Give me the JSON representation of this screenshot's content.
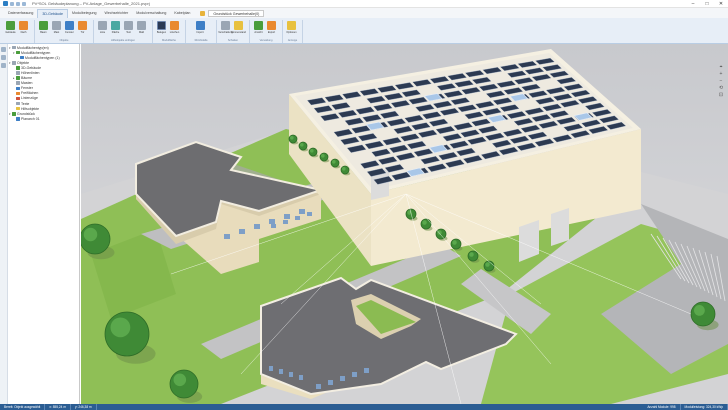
{
  "window": {
    "title": "PV*SOL Gebäudeplanung – PV-Anlage_Gewerbehalle_2021.pvprj",
    "controls": [
      "–",
      "□",
      "✕"
    ]
  },
  "menubar": {
    "tabs": [
      "Datenerfassung",
      "3D-Gebäude",
      "Modulbelegung",
      "Wechselrichter",
      "Modulverschaltung",
      "Kabelplan"
    ],
    "active_tab": "3D-Gebäude",
    "context_selector": "Grundstück Gewerbehalle(0)"
  },
  "ribbon": {
    "groups": [
      {
        "caption": "",
        "buttons": [
          {
            "label": "Gebäude",
            "icon": "building-icon",
            "color": "green"
          },
          {
            "label": "Dach",
            "icon": "roof-icon",
            "color": "orange"
          }
        ]
      },
      {
        "caption": "Objekte",
        "buttons": [
          {
            "label": "Baum",
            "icon": "tree-icon",
            "color": "green"
          },
          {
            "label": "Mast",
            "icon": "pole-icon",
            "color": "grey"
          },
          {
            "label": "Fenster",
            "icon": "window-icon",
            "color": "blue"
          },
          {
            "label": "Tür",
            "icon": "door-icon",
            "color": "orange"
          }
        ]
      },
      {
        "caption": "Hilfsobjekte einfügen",
        "buttons": [
          {
            "label": "Linie",
            "icon": "line-icon",
            "color": "grey"
          },
          {
            "label": "Fläche",
            "icon": "area-icon",
            "color": "teal"
          },
          {
            "label": "Text",
            "icon": "text-icon",
            "color": "grey"
          },
          {
            "label": "Maß",
            "icon": "measure-icon",
            "color": "grey"
          }
        ]
      },
      {
        "caption": "Modulfläche",
        "buttons": [
          {
            "label": "Belegen",
            "icon": "module-icon",
            "color": "solar"
          },
          {
            "label": "Löschen",
            "icon": "delete-icon",
            "color": "orange"
          }
        ]
      },
      {
        "caption": "3D-Modelle",
        "buttons": [
          {
            "label": "Import",
            "icon": "import-icon",
            "color": "blue",
            "wide": true
          }
        ]
      },
      {
        "caption": "Schatten",
        "buttons": [
          {
            "label": "Verschattung",
            "icon": "shade-icon",
            "color": "grey"
          },
          {
            "label": "Sonnenstand",
            "icon": "sun-icon",
            "color": "yellow"
          }
        ]
      },
      {
        "caption": "Verwaltung",
        "buttons": [
          {
            "label": "Ansicht",
            "icon": "view-icon",
            "color": "green"
          },
          {
            "label": "Export",
            "icon": "export-icon",
            "color": "orange"
          }
        ]
      },
      {
        "caption": "Anzeige",
        "buttons": [
          {
            "label": "Optionen",
            "icon": "options-icon",
            "color": "yellow"
          }
        ]
      }
    ]
  },
  "tree": {
    "nodes": [
      {
        "label": "Modulflächentyp(en)",
        "icon": "grey",
        "indent": 0,
        "toggle": "▾"
      },
      {
        "label": "Modulflächentypen",
        "icon": "green",
        "indent": 1,
        "toggle": "▾"
      },
      {
        "label": "Modulflächentypen (1)",
        "icon": "solar",
        "indent": 2,
        "toggle": ""
      },
      {
        "label": "Objekte",
        "icon": "grey",
        "indent": 0,
        "toggle": "▾"
      },
      {
        "label": "3D-Gebäude",
        "icon": "green",
        "indent": 1,
        "toggle": ""
      },
      {
        "label": "Höhenlinien",
        "icon": "grey",
        "indent": 1,
        "toggle": ""
      },
      {
        "label": "Bäume",
        "icon": "green",
        "indent": 1,
        "toggle": "▸"
      },
      {
        "label": "Masten",
        "icon": "grey",
        "indent": 1,
        "toggle": ""
      },
      {
        "label": "Fenster",
        "icon": "blue",
        "indent": 1,
        "toggle": ""
      },
      {
        "label": "Freiflächen",
        "icon": "orange",
        "indent": 1,
        "toggle": ""
      },
      {
        "label": "Linienzüge",
        "icon": "red",
        "indent": 1,
        "toggle": ""
      },
      {
        "label": "Texte",
        "icon": "grey",
        "indent": 1,
        "toggle": ""
      },
      {
        "label": "Hilfsobjekte",
        "icon": "yellow",
        "indent": 1,
        "toggle": ""
      },
      {
        "label": "Grundstück",
        "icon": "green",
        "indent": 0,
        "toggle": "▾"
      },
      {
        "label": "Planarch 01",
        "icon": "blue",
        "indent": 1,
        "toggle": ""
      }
    ]
  },
  "viewport_tools": [
    "⌖",
    "+",
    "−",
    "⟲",
    "⊡"
  ],
  "status": {
    "left": "Bereit: Objekt ausgewählt",
    "coord_x": "x: 855,24 m",
    "coord_y": "y: 246,38 m",
    "modules": "Anzahl Module: 998",
    "power": "Modulleistung: 324,30 kWp"
  }
}
